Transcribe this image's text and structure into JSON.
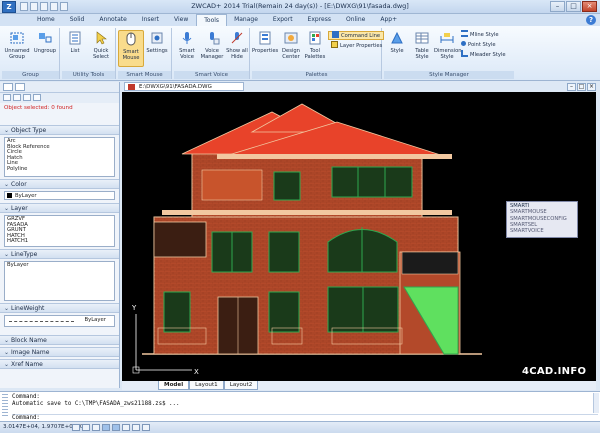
{
  "app": {
    "title": "ZWCAD+ 2014 Trial(Remain 24 day(s)) - [E:\\DWXG\\91\\fasada.dwg]",
    "logo_letter": "Z",
    "window_controls": [
      "–",
      "□",
      "×"
    ]
  },
  "tabs": [
    "Home",
    "Solid",
    "Annotate",
    "Insert",
    "View",
    "Tools",
    "Manage",
    "Export",
    "Express",
    "Online",
    "App+"
  ],
  "active_tab": "Tools",
  "ribbon": {
    "groups": [
      {
        "label": "Group",
        "buttons": [
          "Unnamed Group",
          "Ungroup"
        ]
      },
      {
        "label": "Utility Tools",
        "buttons": [
          "List",
          "Quick Select"
        ]
      },
      {
        "label": "Smart Mouse",
        "buttons": [
          "Smart Mouse",
          "Settings"
        ]
      },
      {
        "label": "Smart Voice",
        "buttons": [
          "Smart Voice",
          "Voice Manager",
          "Show all Hide"
        ]
      },
      {
        "label": "Palettes",
        "buttons": [
          "Properties",
          "Design Center",
          "Tool Palettes"
        ],
        "small": [
          "Command Line",
          "Layer Properties"
        ]
      },
      {
        "label": "Style Manager",
        "buttons": [
          "Style",
          "Table Style",
          "Dimension Style"
        ],
        "small": [
          "Mline Style",
          "Point Style",
          "Mleader Style"
        ]
      }
    ]
  },
  "left_panel": {
    "selection_info": "Object selected: 0 found",
    "sections": {
      "object_type": {
        "title": "Object Type",
        "items": [
          "Arc",
          "Block Reference",
          "Circle",
          "Hatch",
          "Line",
          "Polyline"
        ]
      },
      "color": {
        "title": "Color",
        "value": "ByLayer"
      },
      "layer": {
        "title": "Layer",
        "items": [
          "GRZVF",
          "FASADA",
          "GRUNT",
          "HATCH",
          "HATCH1"
        ]
      },
      "linetype": {
        "title": "LineType",
        "value": "ByLayer"
      },
      "lineweight": {
        "title": "LineWeight",
        "value": "ByLayer"
      },
      "block_name": {
        "title": "Block Name"
      },
      "image_name": {
        "title": "Image Name"
      },
      "xref_name": {
        "title": "Xref Name"
      }
    }
  },
  "document": {
    "tab_label": "E:\\DWXG\\91\\FASADA.DWG",
    "layout_tabs": [
      "Model",
      "Layout1",
      "Layout2"
    ],
    "active_layout": "Model"
  },
  "smart_popup": [
    "SMARTI",
    "SMARTMOUSE",
    "SMARTMOUSECONFIG",
    "SMARTSEL",
    "SMARTVOICE"
  ],
  "watermark": "4CAD.INFO",
  "axes": {
    "x": "X",
    "y": "Y"
  },
  "command": {
    "history": [
      "Command:",
      "Automatic save to C:\\TMP\\FASADA_zws21188.zs$ ..."
    ],
    "prompt": "Command:"
  },
  "status": {
    "coordinates": "3.0147E+04, 1.9707E+04, 0.0"
  },
  "colors": {
    "canvas": "#000000",
    "roof": "#e8432a",
    "brick": "#c8542c",
    "trim": "#f2c8a0",
    "window_green": "#2fa84f",
    "lawn": "#5fe05f",
    "selection_red": "#d12424"
  }
}
